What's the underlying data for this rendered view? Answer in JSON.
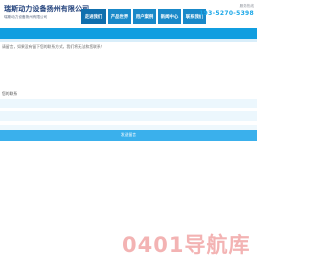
{
  "header": {
    "company_name": "瑞斯动力设备扬州有限公司",
    "company_sub": "瑞斯动力设备扬州有限公司",
    "hotline_label": "服务热线",
    "hotline_number": "193-5270-5398"
  },
  "nav": {
    "items": [
      {
        "label": "走进我们"
      },
      {
        "label": "产品世界"
      },
      {
        "label": "用户案例"
      },
      {
        "label": "新闻中心"
      },
      {
        "label": "联系我们"
      }
    ]
  },
  "form": {
    "notice": "请留言，如果没有留下您的联系方式，我们将无法和您联系！",
    "field_label": "您的联系",
    "submit_label": "发送留言"
  },
  "watermark": {
    "text": "0401导航库"
  },
  "colors": {
    "brand_blue": "#119ee0",
    "nav_blue": "#1989c9",
    "input_bg": "#ecf7fd",
    "submit_blue": "#3ab0ec",
    "watermark_red": "#e24a4a"
  }
}
